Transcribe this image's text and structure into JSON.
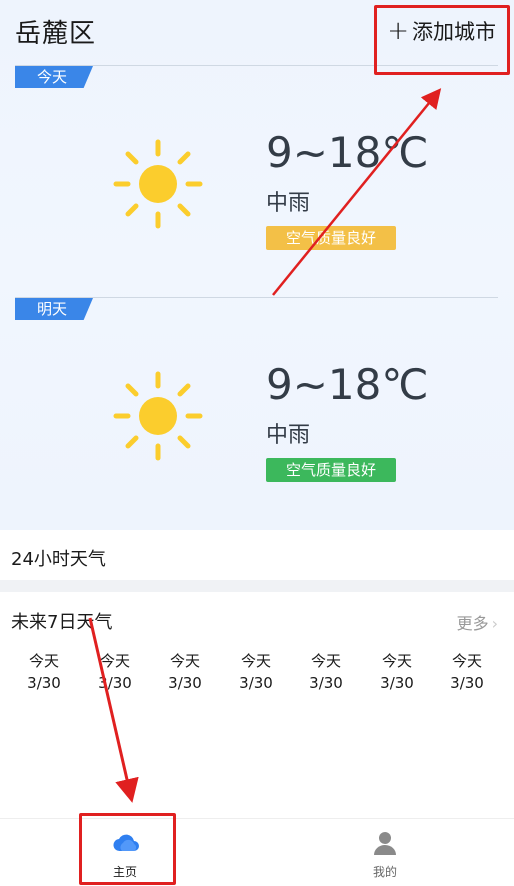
{
  "header": {
    "city": "岳麓区",
    "add_city_plus": "+",
    "add_city_label": "添加城市"
  },
  "today": {
    "tag": "今天",
    "temp": "9~18℃",
    "condition": "中雨",
    "air_quality": "空气质量良好",
    "air_quality_color": "#f3c047",
    "icon": "sun-icon"
  },
  "tomorrow": {
    "tag": "明天",
    "temp": "9~18℃",
    "condition": "中雨",
    "air_quality": "空气质量良好",
    "air_quality_color": "#3cb85c",
    "icon": "sun-icon"
  },
  "hourly": {
    "title": "24小时天气"
  },
  "weekly": {
    "title": "未来7日天气",
    "more": "更多",
    "days": [
      {
        "name": "今天",
        "date": "3/30"
      },
      {
        "name": "今天",
        "date": "3/30"
      },
      {
        "name": "今天",
        "date": "3/30"
      },
      {
        "name": "今天",
        "date": "3/30"
      },
      {
        "name": "今天",
        "date": "3/30"
      },
      {
        "name": "今天",
        "date": "3/30"
      },
      {
        "name": "今天",
        "date": "3/30"
      }
    ]
  },
  "nav": {
    "home": {
      "label": "主页",
      "icon": "cloud-icon",
      "color": "#2f7ff0"
    },
    "mine": {
      "label": "我的",
      "icon": "user-icon",
      "color": "#888888"
    }
  },
  "colors": {
    "accent": "#3a86e8",
    "annotation_red": "#e02020",
    "sun_yellow": "#fbcd2d"
  }
}
